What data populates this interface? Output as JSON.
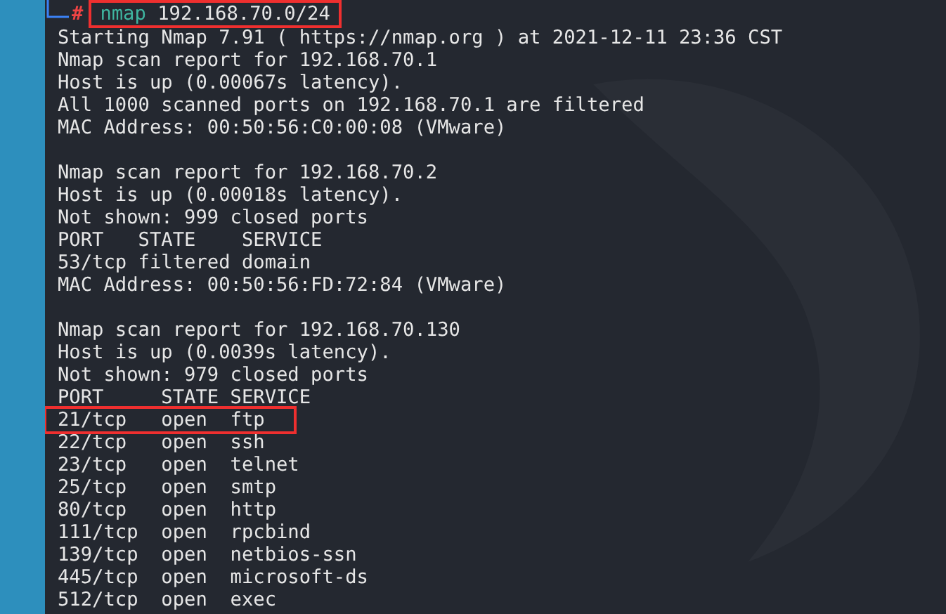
{
  "prompt": {
    "symbol": "#",
    "command": "nmap",
    "arguments": "192.168.70.0/24",
    "highlighted": true
  },
  "blocks": [
    {
      "lines": [
        {
          "text": "Starting Nmap 7.91 ( https://nmap.org ) at 2021-12-11 23:36 CST",
          "highlighted": false
        },
        {
          "text": "Nmap scan report for 192.168.70.1",
          "highlighted": false
        },
        {
          "text": "Host is up (0.00067s latency).",
          "highlighted": false
        },
        {
          "text": "All 1000 scanned ports on 192.168.70.1 are filtered",
          "highlighted": false
        },
        {
          "text": "MAC Address: 00:50:56:C0:00:08 (VMware)",
          "highlighted": false
        }
      ]
    },
    {
      "lines": [
        {
          "text": "Nmap scan report for 192.168.70.2",
          "highlighted": false
        },
        {
          "text": "Host is up (0.00018s latency).",
          "highlighted": false
        },
        {
          "text": "Not shown: 999 closed ports",
          "highlighted": false
        },
        {
          "text": "PORT   STATE    SERVICE",
          "highlighted": false
        },
        {
          "text": "53/tcp filtered domain",
          "highlighted": false
        },
        {
          "text": "MAC Address: 00:50:56:FD:72:84 (VMware)",
          "highlighted": false
        }
      ]
    },
    {
      "lines": [
        {
          "text": "Nmap scan report for 192.168.70.130",
          "highlighted": false
        },
        {
          "text": "Host is up (0.0039s latency).",
          "highlighted": false
        },
        {
          "text": "Not shown: 979 closed ports",
          "highlighted": false
        },
        {
          "text": "PORT     STATE SERVICE",
          "highlighted": false
        },
        {
          "text": "21/tcp   open  ftp",
          "highlighted": true
        },
        {
          "text": "22/tcp   open  ssh",
          "highlighted": false
        },
        {
          "text": "23/tcp   open  telnet",
          "highlighted": false
        },
        {
          "text": "25/tcp   open  smtp",
          "highlighted": false
        },
        {
          "text": "80/tcp   open  http",
          "highlighted": false
        },
        {
          "text": "111/tcp  open  rpcbind",
          "highlighted": false
        },
        {
          "text": "139/tcp  open  netbios-ssn",
          "highlighted": false
        },
        {
          "text": "445/tcp  open  microsoft-ds",
          "highlighted": false
        },
        {
          "text": "512/tcp  open  exec",
          "highlighted": false
        }
      ]
    }
  ]
}
